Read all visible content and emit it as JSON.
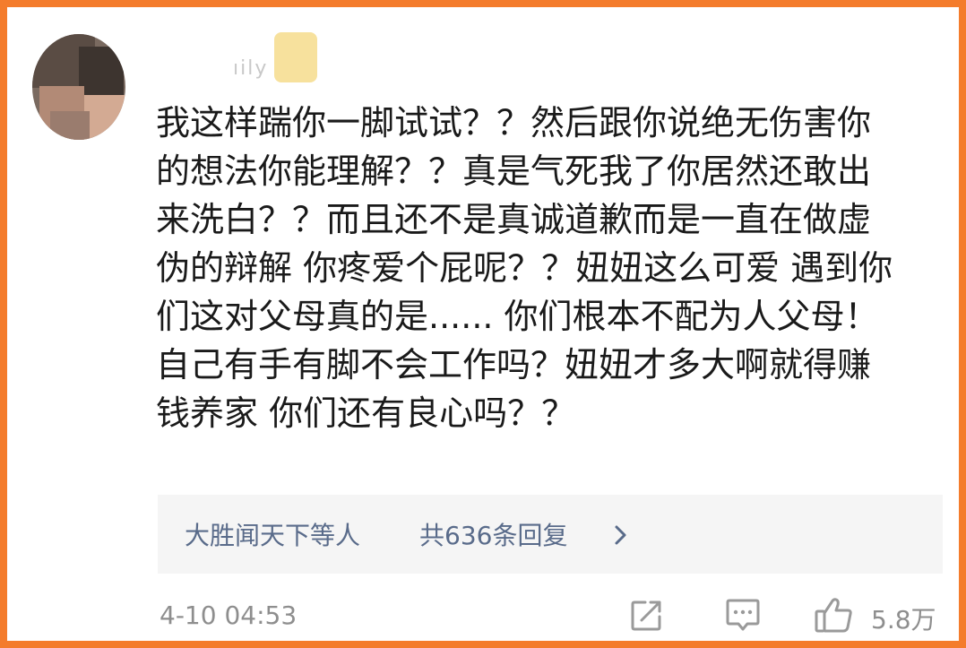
{
  "post": {
    "username": "ıily",
    "comment_lines": [
      "我这样踹你一脚试试？？然后跟你说绝无伤害你",
      "的想法你能理解？？真是气死我了你居然还敢出",
      "来洗白？？而且还不是真诚道歉而是一直在做虚",
      "伪的辩解 你疼爱个屁呢？？妞妞这么可爱 遇到你",
      "们这对父母真的是...... 你们根本不配为人父母！",
      "自己有手有脚不会工作吗？妞妞才多大啊就得赚",
      "钱养家 你们还有良心吗？？"
    ]
  },
  "replies": {
    "users": "大胜闻天下等人",
    "count_text": "共636条回复",
    "arrow_icon": "chevron-right-icon"
  },
  "footer": {
    "timestamp": "4-10 04:53",
    "share_icon": "share-icon",
    "comment_icon": "comment-icon",
    "like_icon": "thumbs-up-icon",
    "like_count": "5.8万"
  },
  "colors": {
    "frame_border": "#f47c2c",
    "link_blue": "#596b8a",
    "meta_gray": "#8e8e8e",
    "reply_bg": "#f5f5f5"
  }
}
